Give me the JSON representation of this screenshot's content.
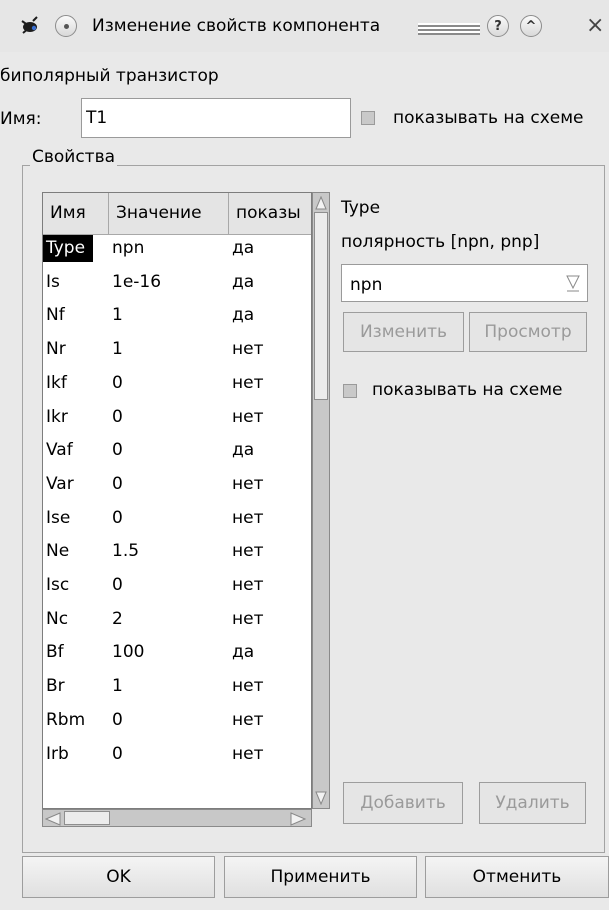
{
  "window": {
    "title": "Изменение свойств компонента",
    "help_label": "?",
    "shade_label": "^",
    "close_label": "×"
  },
  "component": {
    "type": "биполярный транзистор",
    "name_label": "Имя:",
    "name_value": "T1",
    "show_on_schematic": "показывать на схеме"
  },
  "properties": {
    "group_title": "Свойства",
    "columns": [
      "Имя",
      "Значение",
      "показы"
    ],
    "rows": [
      {
        "name": "Type",
        "value": "npn",
        "show": "да"
      },
      {
        "name": "Is",
        "value": "1e-16",
        "show": "да"
      },
      {
        "name": "Nf",
        "value": "1",
        "show": "да"
      },
      {
        "name": "Nr",
        "value": "1",
        "show": "нет"
      },
      {
        "name": "Ikf",
        "value": "0",
        "show": "нет"
      },
      {
        "name": "Ikr",
        "value": "0",
        "show": "нет"
      },
      {
        "name": "Vaf",
        "value": "0",
        "show": "да"
      },
      {
        "name": "Var",
        "value": "0",
        "show": "нет"
      },
      {
        "name": "Ise",
        "value": "0",
        "show": "нет"
      },
      {
        "name": "Ne",
        "value": "1.5",
        "show": "нет"
      },
      {
        "name": "Isc",
        "value": "0",
        "show": "нет"
      },
      {
        "name": "Nc",
        "value": "2",
        "show": "нет"
      },
      {
        "name": "Bf",
        "value": "100",
        "show": "да"
      },
      {
        "name": "Br",
        "value": "1",
        "show": "нет"
      },
      {
        "name": "Rbm",
        "value": "0",
        "show": "нет"
      },
      {
        "name": "Irb",
        "value": "0",
        "show": "нет"
      }
    ],
    "selected_index": 0
  },
  "editor": {
    "prop_name": "Type",
    "prop_description": "полярность [npn, pnp]",
    "combo_value": "npn",
    "change_label": "Изменить",
    "browse_label": "Просмотр",
    "show_label": "показывать на схеме",
    "add_label": "Добавить",
    "remove_label": "Удалить"
  },
  "footer": {
    "ok_label": "OK",
    "apply_label": "Применить",
    "cancel_label": "Отменить"
  }
}
